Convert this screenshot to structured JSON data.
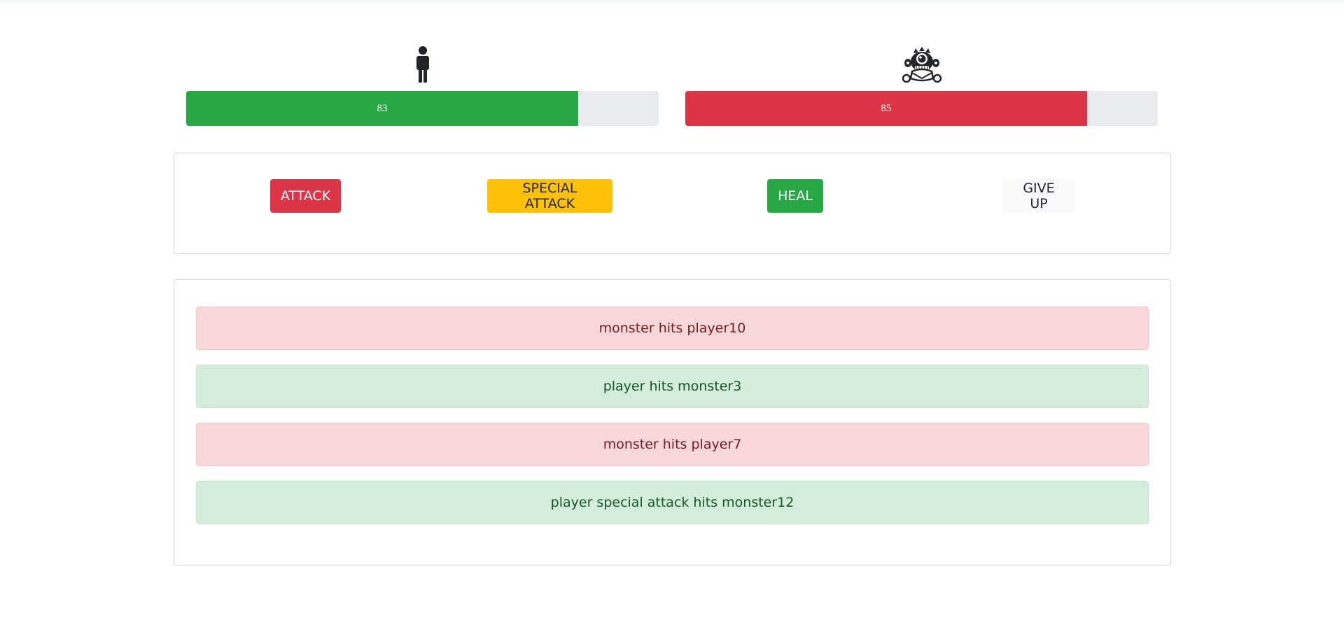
{
  "player": {
    "icon": "person-icon",
    "health": 83,
    "health_label": "83",
    "bar_color": "#28a745"
  },
  "monster": {
    "icon": "monster-icon",
    "health": 85,
    "health_label": "85",
    "bar_color": "#dc3545"
  },
  "controls": {
    "attack_label": "ATTACK",
    "special_attack_label": "SPECIAL ATTACK",
    "heal_label": "HEAL",
    "give_up_label": "GIVE UP",
    "colors": {
      "attack": "#dc3545",
      "special_attack": "#ffc107",
      "heal": "#28a745",
      "give_up": "#f8f9fa"
    }
  },
  "log": [
    {
      "text": "monster hits player10",
      "actor": "monster"
    },
    {
      "text": "player hits monster3",
      "actor": "player"
    },
    {
      "text": "monster hits player7",
      "actor": "monster"
    },
    {
      "text": "player special attack hits monster12",
      "actor": "player"
    }
  ]
}
